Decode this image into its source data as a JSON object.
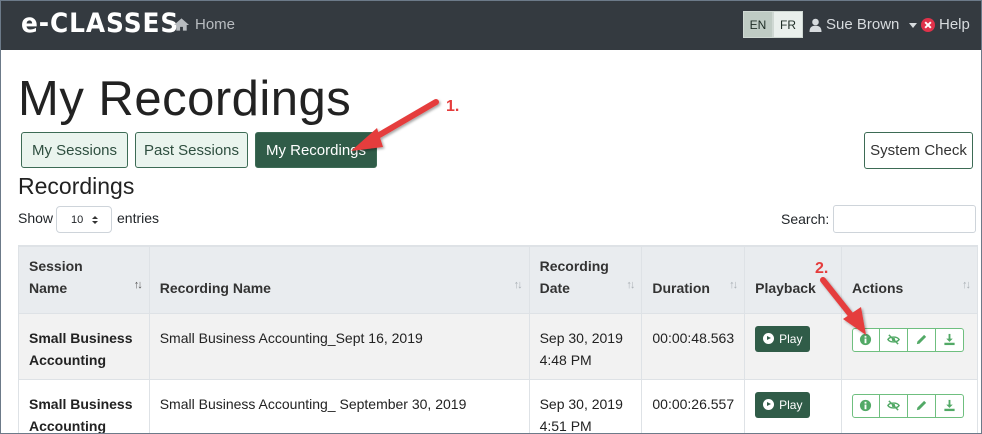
{
  "navbar": {
    "brand": "e-CLASSES",
    "home_label": "Home",
    "lang_en": "EN",
    "lang_fr": "FR",
    "user_name": "Sue Brown",
    "help_label": "Help"
  },
  "page": {
    "title": "My Recordings",
    "tabs": [
      {
        "label": "My Sessions"
      },
      {
        "label": "Past Sessions"
      },
      {
        "label": "My Recordings"
      }
    ],
    "system_check_label": "System Check",
    "section_title": "Recordings"
  },
  "controls": {
    "show_label": "Show",
    "entries_value": "10",
    "entries_label": "entries",
    "search_label": "Search:",
    "search_value": ""
  },
  "table": {
    "headers": {
      "session_name_1": "Session",
      "session_name_2": "Name",
      "recording_name": "Recording Name",
      "recording_date_1": "Recording",
      "recording_date_2": "Date",
      "duration": "Duration",
      "playback": "Playback",
      "actions": "Actions"
    },
    "play_label": "Play",
    "rows": [
      {
        "session_line1": "Small Business",
        "session_line2": "Accounting",
        "recording_name": "Small Business Accounting_Sept 16, 2019",
        "date_line1": "Sep 30, 2019",
        "date_line2": "4:48 PM",
        "duration": "00:00:48.563"
      },
      {
        "session_line1": "Small Business",
        "session_line2": "Accounting",
        "recording_name": "Small Business Accounting_ September 30, 2019",
        "date_line1": "Sep 30, 2019",
        "date_line2": "4:51 PM",
        "duration": "00:00:26.557"
      }
    ]
  },
  "annotations": {
    "step1": "1.",
    "step2": "2.",
    "color": "#e53c3c"
  },
  "colors": {
    "navbar_bg": "#343a40",
    "primary_green": "#305c48",
    "action_green": "#52a966"
  }
}
